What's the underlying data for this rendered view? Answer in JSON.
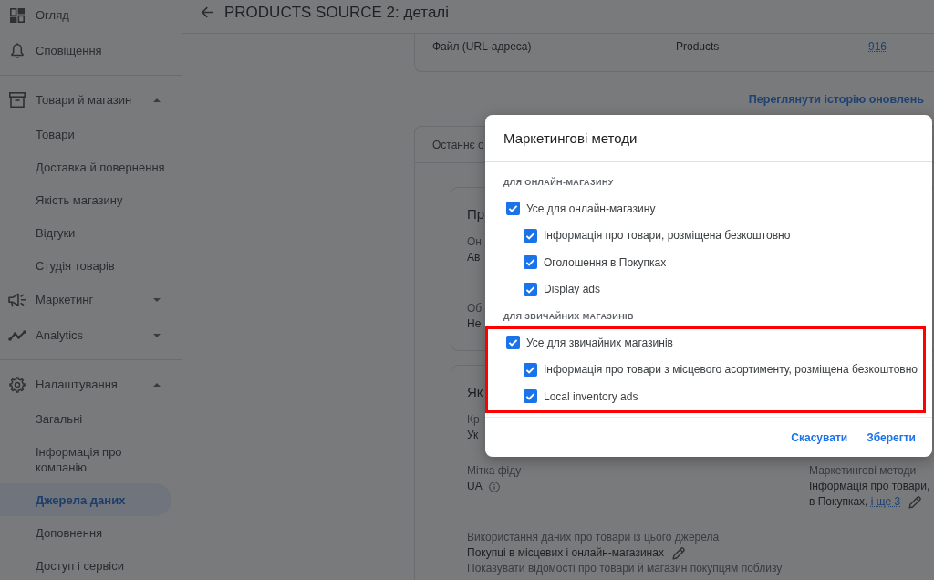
{
  "sidebar": {
    "groups": [
      {
        "items": [
          {
            "label": "Огляд",
            "selected": false
          },
          {
            "label": "Сповіщення",
            "selected": false
          }
        ]
      },
      {
        "items": [
          {
            "label": "Товари й магазин",
            "expanded": true,
            "children": [
              {
                "label": "Товари",
                "selected": false
              },
              {
                "label": "Доставка й повернення",
                "selected": false
              },
              {
                "label": "Якість магазину",
                "selected": false
              },
              {
                "label": "Відгуки",
                "selected": false
              },
              {
                "label": "Студія товарів",
                "selected": false
              }
            ]
          },
          {
            "label": "Маркетинг",
            "expanded": false
          },
          {
            "label": "Analytics",
            "expanded": false
          }
        ]
      },
      {
        "items": [
          {
            "label": "Налаштування",
            "expanded": true,
            "children": [
              {
                "label": "Загальні",
                "selected": false
              },
              {
                "label": "Інформація про компанію",
                "selected": false
              },
              {
                "label": "Джерела даних",
                "selected": true
              },
              {
                "label": "Доповнення",
                "selected": false
              },
              {
                "label": "Доступ і сервіси",
                "selected": false
              }
            ]
          }
        ]
      }
    ]
  },
  "header": {
    "title": "PRODUCTS SOURCE 2: деталі"
  },
  "source_card": {
    "fields": [
      {
        "kind": "text",
        "value": "Файл (URL-адреса)"
      },
      {
        "kind": "text",
        "value": "Products"
      },
      {
        "kind": "link",
        "value": "916"
      }
    ]
  },
  "history_link": "Переглянути історію оновлень",
  "details": {
    "heading": "Останнє о",
    "cards": [
      {
        "title": "Пр",
        "rows": [
          {
            "cells": [
              {
                "label": "Он",
                "value": "Ав"
              }
            ]
          },
          {
            "cells": [
              {
                "label": "Об",
                "value": "Не"
              }
            ]
          }
        ]
      },
      {
        "title": "Як",
        "rows": [
          {
            "cells": [
              {
                "label": "Кр",
                "value": "Ук"
              }
            ]
          },
          {
            "cells": [
              {
                "label": "Мітка фіду",
                "value": "UA",
                "info": true
              },
              {
                "label": "Маркетингові методи",
                "value_lines": [
                  "Інформація про товари,",
                  "в Покупках,"
                ],
                "link": "і ще 3",
                "editable": true
              }
            ]
          },
          {
            "cells": [
              {
                "label": "Використання даних про товари із цього джерела",
                "value": "Покупці в місцевих і онлайн-магазинах",
                "editable": true,
                "note": "Показувати відомості про товари й магазин покупцям поблизу"
              }
            ]
          }
        ]
      }
    ]
  },
  "dialog": {
    "title": "Маркетингові методи",
    "sections": [
      {
        "heading": "ДЛЯ ОНЛАЙН-МАГАЗИНУ",
        "highlighted": false,
        "options": [
          {
            "label": "Усе для онлайн-магазину",
            "checked": true,
            "children": [
              {
                "label": "Інформація про товари, розміщена безкоштовно",
                "checked": true
              },
              {
                "label": "Оголошення в Покупках",
                "checked": true
              },
              {
                "label": "Display ads",
                "checked": true
              }
            ]
          }
        ]
      },
      {
        "heading": "ДЛЯ ЗВИЧАЙНИХ МАГАЗИНІВ",
        "highlighted": true,
        "options": [
          {
            "label": "Усе для звичайних магазинів",
            "checked": true,
            "children": [
              {
                "label": "Інформація про товари з місцевого асортименту, розміщена безкоштовно",
                "checked": true
              },
              {
                "label": "Local inventory ads",
                "checked": true
              }
            ]
          }
        ]
      }
    ],
    "actions": [
      "Скасувати",
      "Зберегти"
    ]
  }
}
